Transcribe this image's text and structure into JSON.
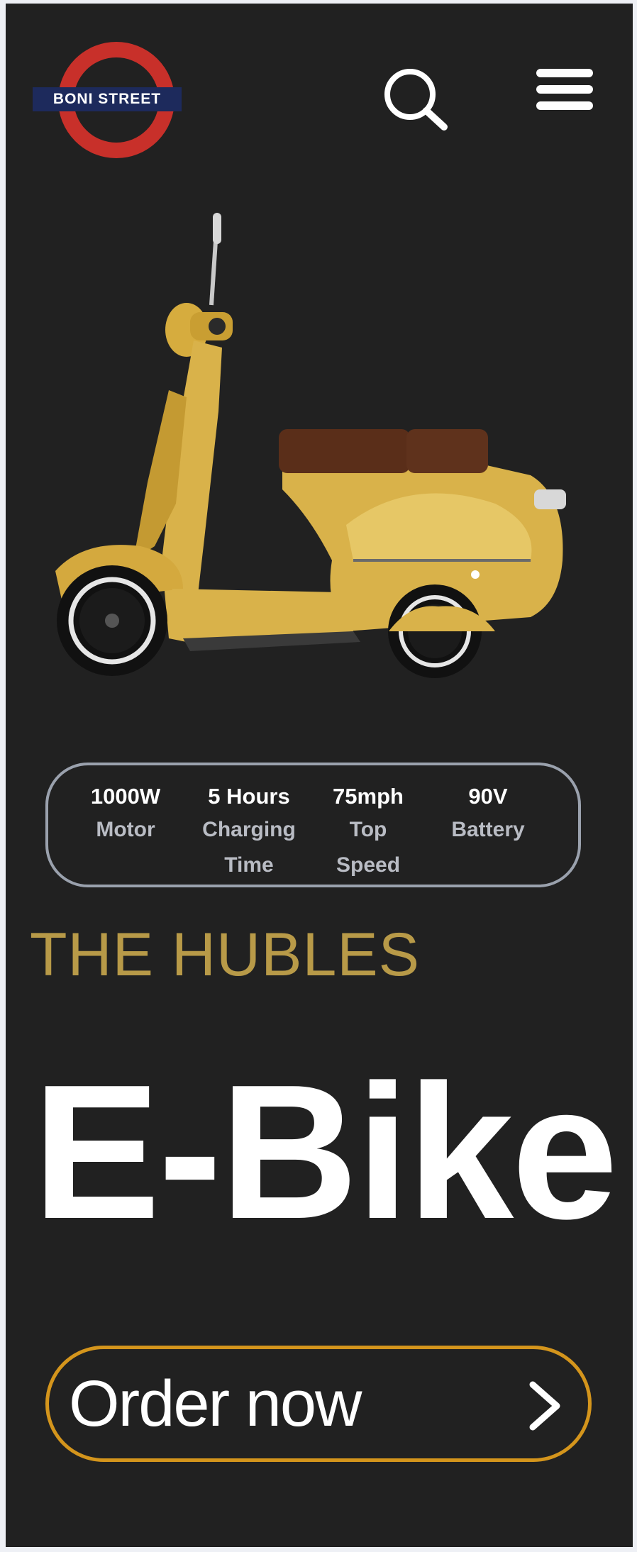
{
  "logo": {
    "text": "BONI STREET",
    "ring_color": "#c8302a",
    "bar_color": "#1d2a5c"
  },
  "header": {
    "search_icon": "search-icon",
    "menu_icon": "hamburger-menu-icon"
  },
  "hero_image": {
    "subject": "yellow retro e-scooter",
    "body_color": "#d9b24a",
    "seat_color": "#5a2e19"
  },
  "specs": [
    {
      "value": "1000W",
      "label_1": "Motor",
      "label_2": ""
    },
    {
      "value": "5 Hours",
      "label_1": "Charging",
      "label_2": "Time"
    },
    {
      "value": "75mph",
      "label_1": "Top",
      "label_2": "Speed"
    },
    {
      "value": "90V",
      "label_1": "Battery",
      "label_2": ""
    }
  ],
  "brand": "THE HUBLES",
  "title": "E-Bike",
  "cta": {
    "label": "Order now",
    "icon": "chevron-right-icon"
  },
  "colors": {
    "background": "#212121",
    "brand_gold": "#b89a48",
    "cta_border": "#d4951c",
    "spec_border": "#9aa1ad"
  }
}
